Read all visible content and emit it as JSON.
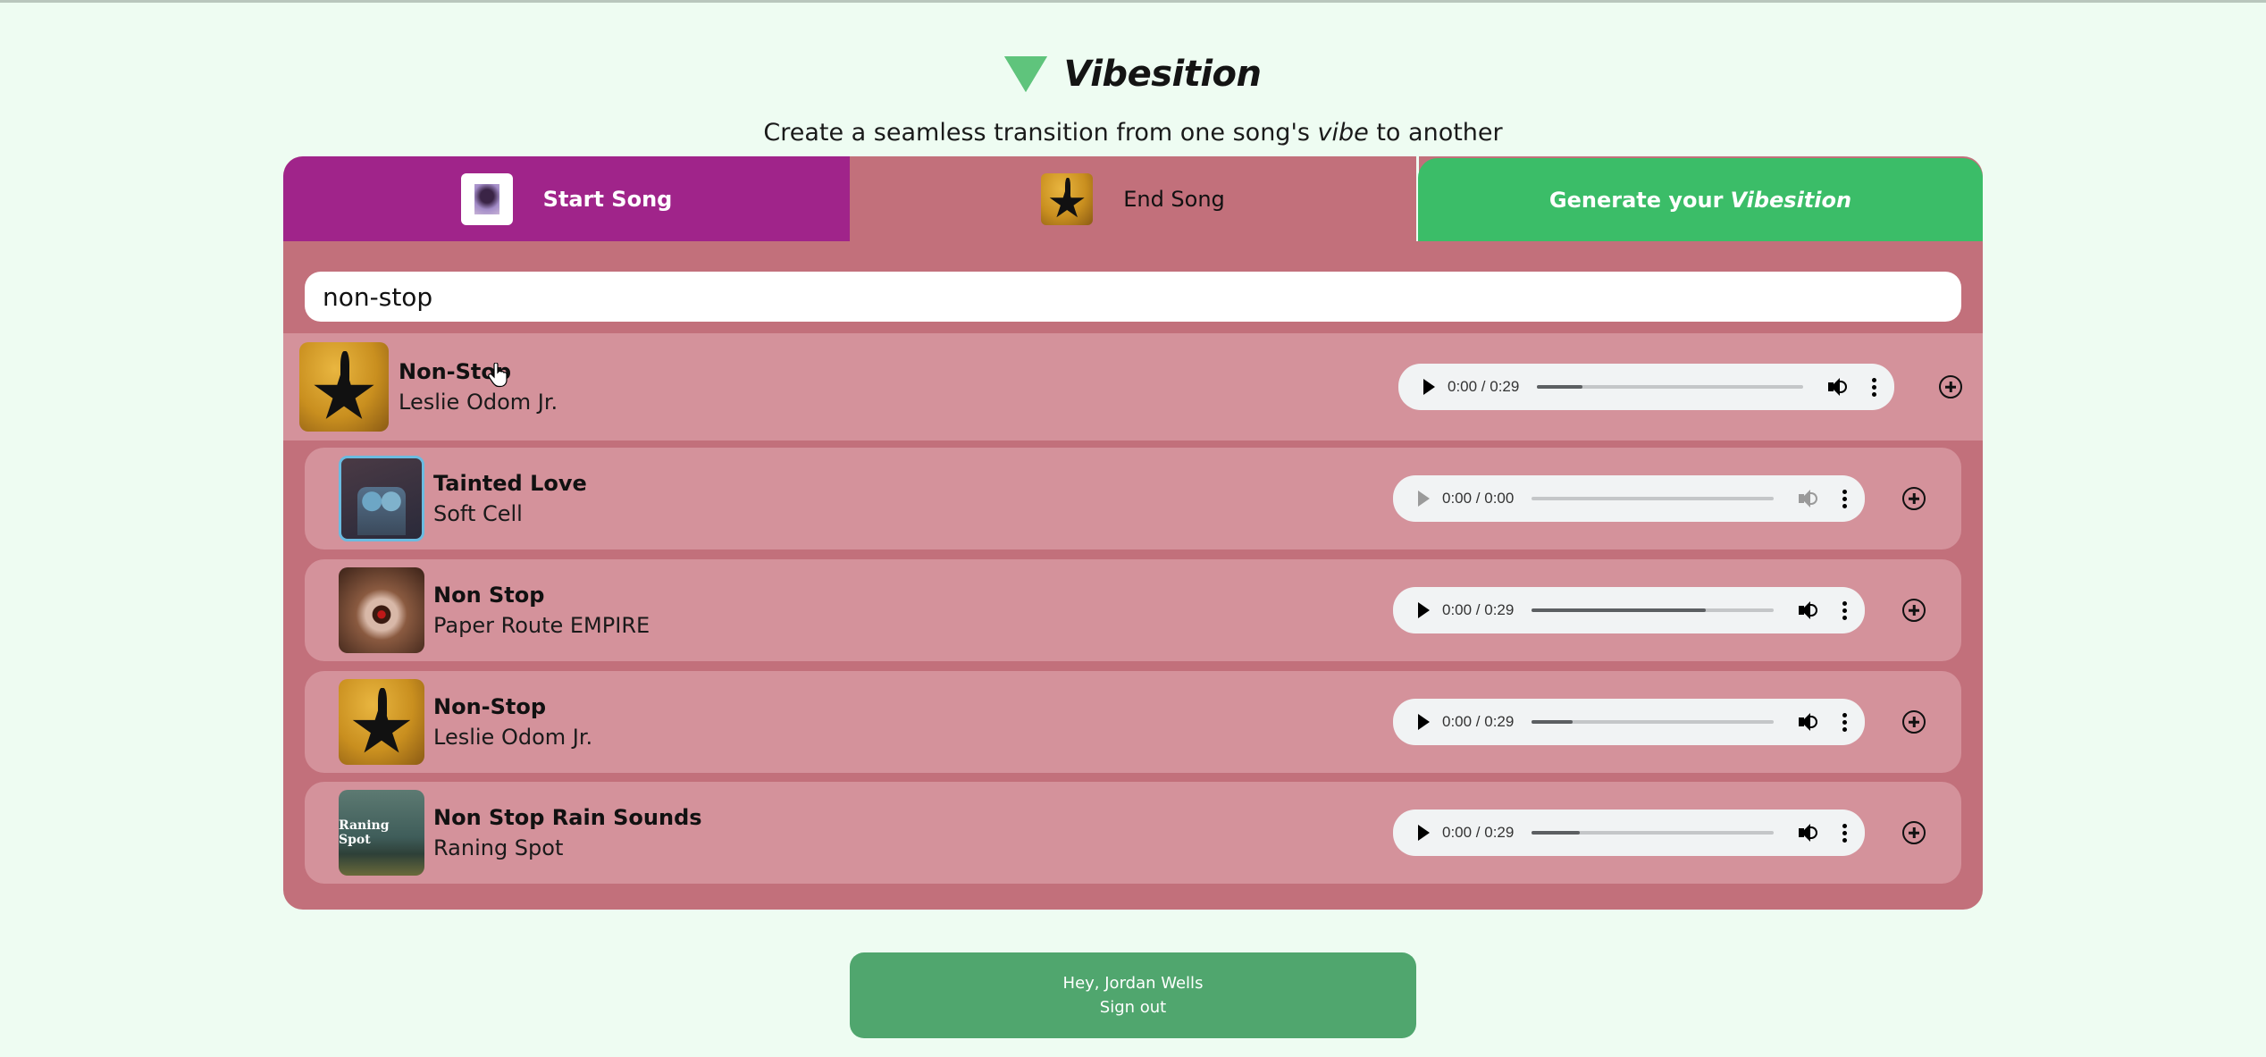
{
  "app": {
    "title": "Vibesition",
    "logo_icon": "green-down-triangle",
    "subtitle_before": "Create a seamless transition from one song's ",
    "subtitle_em": "vibe",
    "subtitle_after": " to another"
  },
  "tabs": {
    "start": {
      "label": "Start Song",
      "thumb": "album-art-purple-portrait",
      "color": "#a0248a"
    },
    "end": {
      "label": "End Song",
      "thumb": "album-art-hamilton",
      "color": "#c2707b",
      "active": true
    },
    "generate": {
      "label": "Generate your",
      "label_em": "Vibesition",
      "color": "#3bbd68"
    }
  },
  "search": {
    "value": "non-stop",
    "placeholder": ""
  },
  "results": [
    {
      "title": "Non-Stop",
      "artist": "Leslie Odom Jr.",
      "art": "hamilton",
      "time": "0:00 / 0:29",
      "buffered": 0.17,
      "disabled": false,
      "hovered": true
    },
    {
      "title": "Tainted Love",
      "artist": "Soft Cell",
      "art": "softcell",
      "time": "0:00 / 0:00",
      "buffered": 0,
      "disabled": true,
      "hovered": false
    },
    {
      "title": "Non Stop",
      "artist": "Paper Route EMPIRE",
      "art": "paper-route",
      "time": "0:00 / 0:29",
      "buffered": 0.72,
      "disabled": false,
      "hovered": false
    },
    {
      "title": "Non-Stop",
      "artist": "Leslie Odom Jr.",
      "art": "hamilton",
      "time": "0:00 / 0:29",
      "buffered": 0.17,
      "disabled": false,
      "hovered": false
    },
    {
      "title": "Non Stop Rain Sounds",
      "artist": "Raning Spot",
      "art": "rain",
      "art_text": "Raning Spot",
      "time": "0:00 / 0:29",
      "buffered": 0.2,
      "disabled": false,
      "hovered": false
    }
  ],
  "icons": {
    "play": "play-icon",
    "volume": "volume-icon",
    "more": "more-vert-icon",
    "add": "add-circle-icon"
  },
  "footer": {
    "greeting": "Hey, Jordan Wells",
    "signout": "Sign out"
  }
}
